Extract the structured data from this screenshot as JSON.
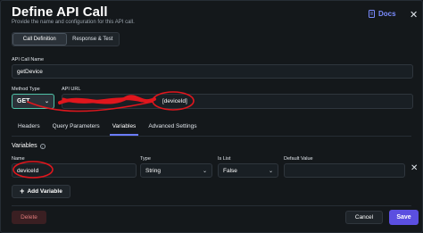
{
  "header": {
    "title": "Define API Call",
    "subtitle": "Provide the name and configuration for this API call.",
    "docs_label": "Docs",
    "close_glyph": "✕"
  },
  "mode_tabs": [
    {
      "label": "Call Definition",
      "active": true
    },
    {
      "label": "Response & Test",
      "active": false
    }
  ],
  "api_call_name": {
    "label": "API Call Name",
    "value": "getDevice"
  },
  "method_type": {
    "label": "Method Type",
    "value": "GET"
  },
  "api_url": {
    "label": "API URL",
    "value": "[deviceId]"
  },
  "sub_tabs": [
    {
      "label": "Headers",
      "active": false
    },
    {
      "label": "Query Parameters",
      "active": false
    },
    {
      "label": "Variables",
      "active": true
    },
    {
      "label": "Advanced Settings",
      "active": false
    }
  ],
  "variables": {
    "title": "Variables",
    "columns": {
      "name": "Name",
      "type": "Type",
      "is_list": "Is List",
      "default_value": "Default Value"
    },
    "rows": [
      {
        "name": "deviceId",
        "type": "String",
        "is_list": "False",
        "default_value": ""
      }
    ],
    "add_label": "Add Variable"
  },
  "footer": {
    "delete_label": "Delete",
    "cancel_label": "Cancel",
    "save_label": "Save"
  },
  "colors": {
    "background": "#14181b",
    "accent": "#5b4fe0",
    "method_border": "#4fc3a8",
    "annotation_red": "#e0161d"
  },
  "icons": [
    "docs-icon",
    "close-icon",
    "info-icon",
    "chevron-down-icon",
    "plus-icon",
    "remove-row-icon"
  ]
}
